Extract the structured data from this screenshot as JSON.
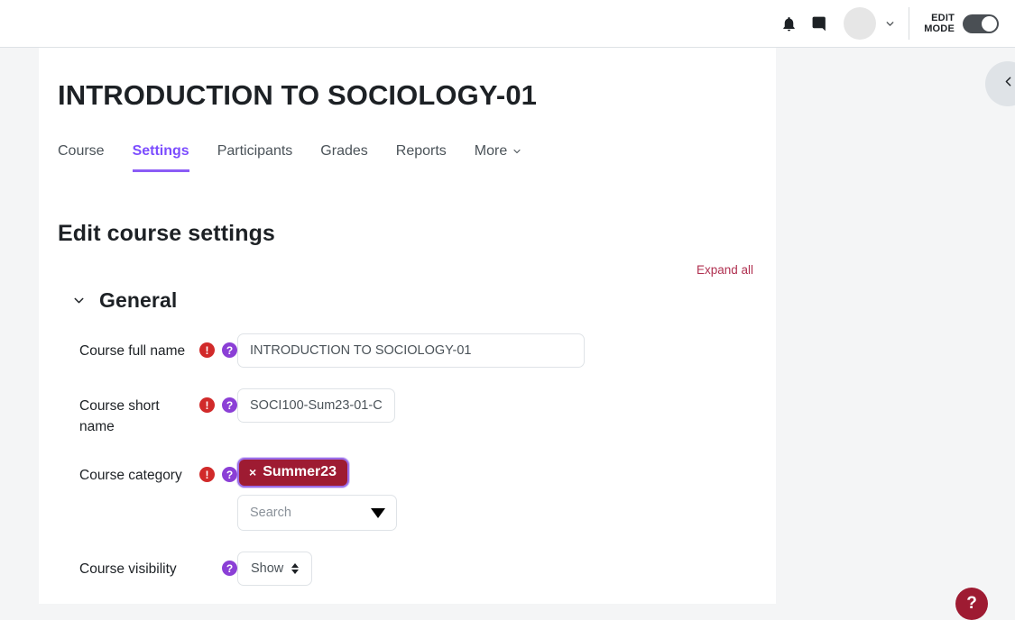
{
  "navbar": {
    "notifications_icon": "bell-icon",
    "messages_icon": "speech-bubble-icon",
    "avatar_icon": "user-avatar",
    "avatar_chevron_icon": "chevron-down-icon",
    "edit_mode_label": "EDIT\nMODE",
    "edit_mode_on": true
  },
  "course": {
    "title": "INTRODUCTION TO SOCIOLOGY-01"
  },
  "tabs": [
    {
      "label": "Course",
      "active": false
    },
    {
      "label": "Settings",
      "active": true
    },
    {
      "label": "Participants",
      "active": false
    },
    {
      "label": "Grades",
      "active": false
    },
    {
      "label": "Reports",
      "active": false
    },
    {
      "label": "More",
      "active": false,
      "has_chevron": true
    }
  ],
  "page": {
    "heading": "Edit course settings",
    "expand_all_label": "Expand all"
  },
  "section": {
    "title": "General",
    "chevron_icon": "chevron-down-icon",
    "expanded": true
  },
  "form": {
    "fields": [
      {
        "label": "Course full name",
        "required": true,
        "required_badge": "!",
        "help_badge": "?",
        "type": "text",
        "value": "INTRODUCTION TO SOCIOLOGY-01"
      },
      {
        "label": "Course short name",
        "required": true,
        "required_badge": "!",
        "help_badge": "?",
        "type": "text",
        "value": "SOCI100-Sum23-01-C"
      },
      {
        "label": "Course category",
        "required": true,
        "required_badge": "!",
        "help_badge": "?",
        "type": "autocomplete",
        "selected_tag": "Summer23",
        "tag_remove_label": "×",
        "search_placeholder": "Search",
        "caret_icon": "triangle-down-icon"
      },
      {
        "label": "Course visibility",
        "required": false,
        "help_badge": "?",
        "type": "select",
        "value": "Show"
      }
    ]
  },
  "drawer": {
    "toggle_icon": "chevron-left-icon"
  },
  "help_fab": {
    "label": "?"
  },
  "colors": {
    "accent_purple": "#7c4dff",
    "link_red": "#b03050",
    "tag_maroon": "#9e1b32",
    "required_red": "#d12a2a",
    "help_purple": "#8b3fd6",
    "page_bg": "#f4f5f6",
    "card_bg": "#ffffff"
  }
}
